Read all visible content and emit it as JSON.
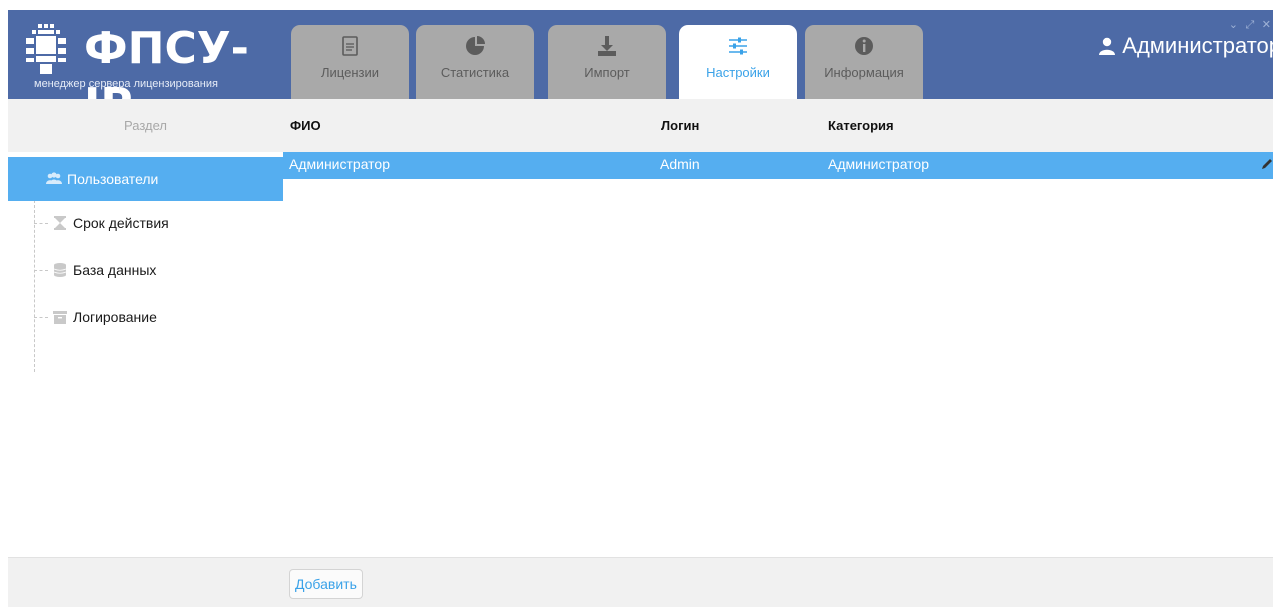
{
  "logo": {
    "title": "ФПСУ-IP",
    "subtitle": "менеджер сервера лицензирования"
  },
  "tabs": [
    {
      "label": "Лицензии",
      "icon": "document-icon",
      "active": false
    },
    {
      "label": "Статистика",
      "icon": "pie-chart-icon",
      "active": false
    },
    {
      "label": "Импорт",
      "icon": "download-icon",
      "active": false
    },
    {
      "label": "Настройки",
      "icon": "sliders-icon",
      "active": true
    },
    {
      "label": "Информация",
      "icon": "info-icon",
      "active": false
    }
  ],
  "user": {
    "name": "Администратор",
    "icon": "user-icon"
  },
  "columns": {
    "section": "Раздел",
    "fio": "ФИО",
    "login": "Логин",
    "category": "Категория"
  },
  "sidebar": {
    "items": [
      {
        "label": "Пользователи",
        "icon": "users-icon",
        "selected": true
      },
      {
        "label": "Срок действия",
        "icon": "hourglass-icon",
        "selected": false
      },
      {
        "label": "База данных",
        "icon": "database-icon",
        "selected": false
      },
      {
        "label": "Логирование",
        "icon": "archive-icon",
        "selected": false
      }
    ]
  },
  "table": {
    "rows": [
      {
        "fio": "Администратор",
        "login": "Admin",
        "category": "Администратор",
        "selected": true
      }
    ]
  },
  "footer": {
    "add_label": "Добавить"
  },
  "colors": {
    "header_bg": "#4d6aa6",
    "accent": "#55aef0",
    "tab_inactive": "#a9a9a9",
    "band_bg": "#f1f1f1"
  }
}
